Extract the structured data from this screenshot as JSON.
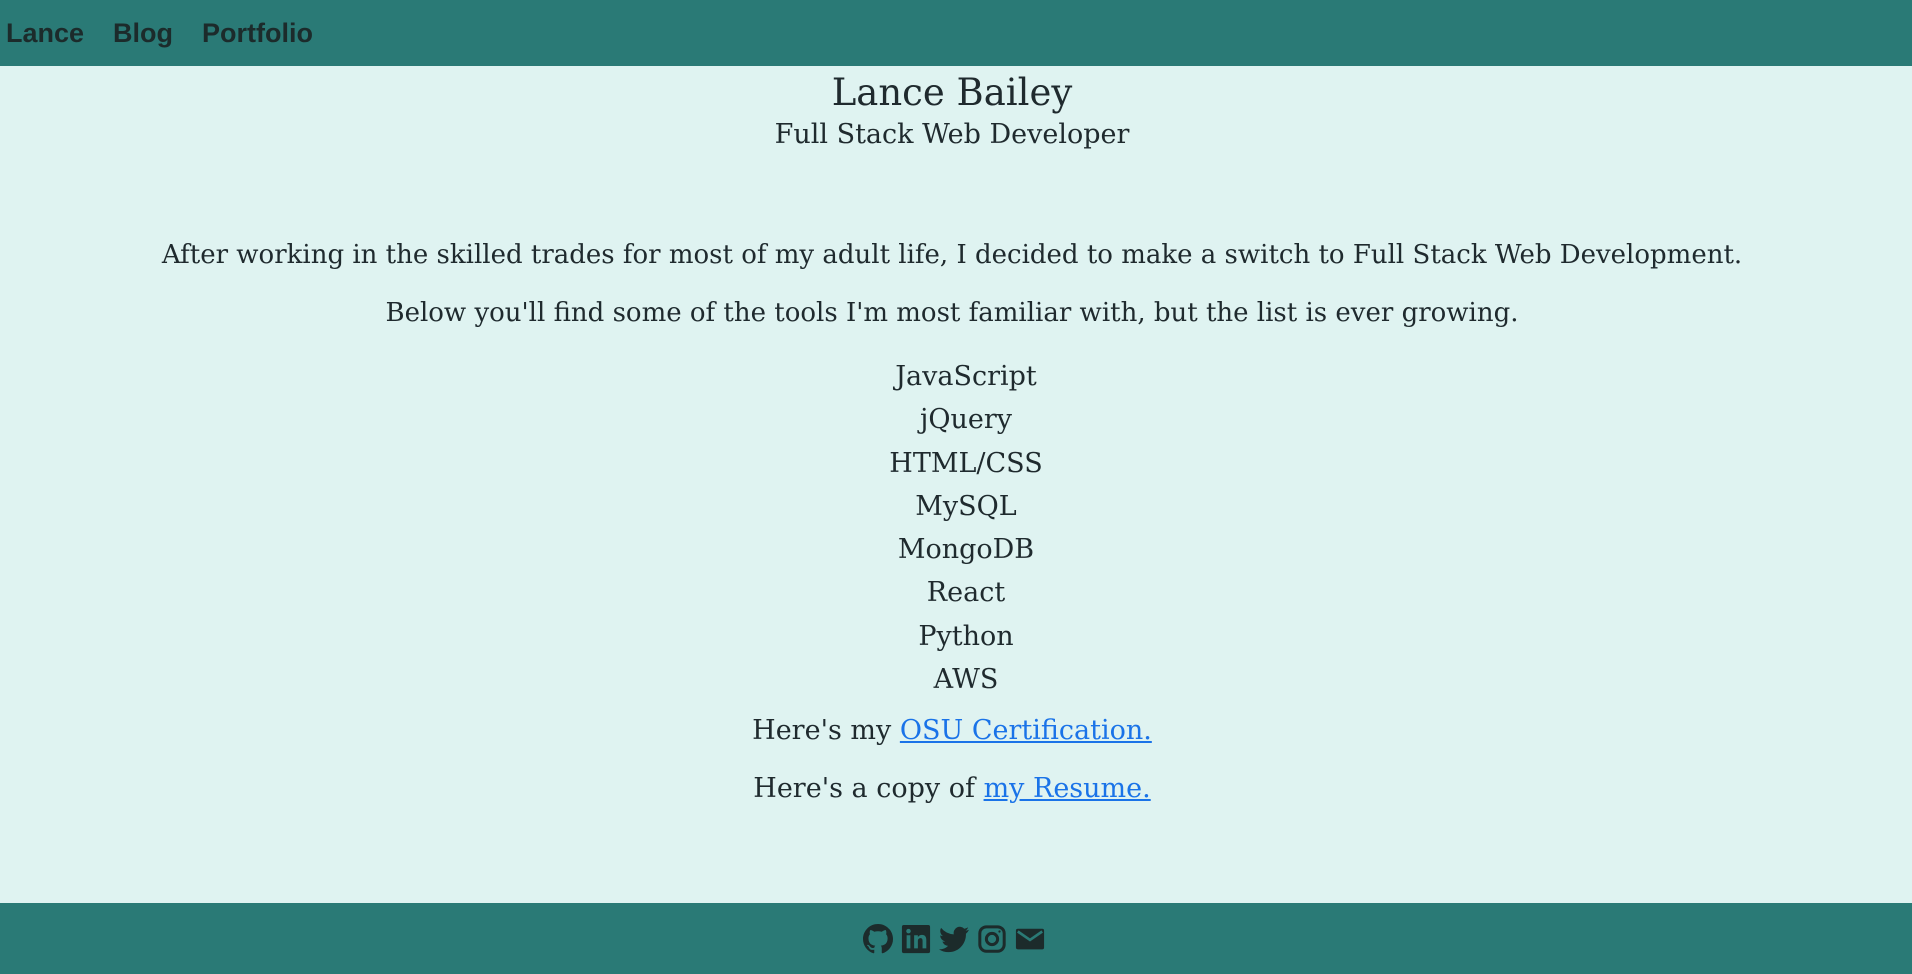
{
  "nav": {
    "brand": "Lance",
    "links": [
      "Blog",
      "Portfolio"
    ]
  },
  "header": {
    "name": "Lance Bailey",
    "title": "Full Stack Web Developer"
  },
  "intro": {
    "line1": "After working in the skilled trades for most of my adult life, I decided to make a switch to Full Stack Web Development.",
    "line2": "Below you'll find some of the tools I'm most familiar with, but the list is ever growing."
  },
  "skills": [
    "JavaScript",
    "jQuery",
    "HTML/CSS",
    "MySQL",
    "MongoDB",
    "React",
    "Python",
    "AWS"
  ],
  "links": {
    "cert_prefix": "Here's my ",
    "cert_link": "OSU Certification.",
    "resume_prefix": "Here's a copy of ",
    "resume_link": "my Resume."
  },
  "footer": {
    "icons": [
      "github-icon",
      "linkedin-icon",
      "twitter-icon",
      "instagram-icon",
      "email-icon"
    ]
  },
  "colors": {
    "header_bg": "#2a7a76",
    "page_bg": "#dff3f1",
    "link": "#1a73e8"
  }
}
